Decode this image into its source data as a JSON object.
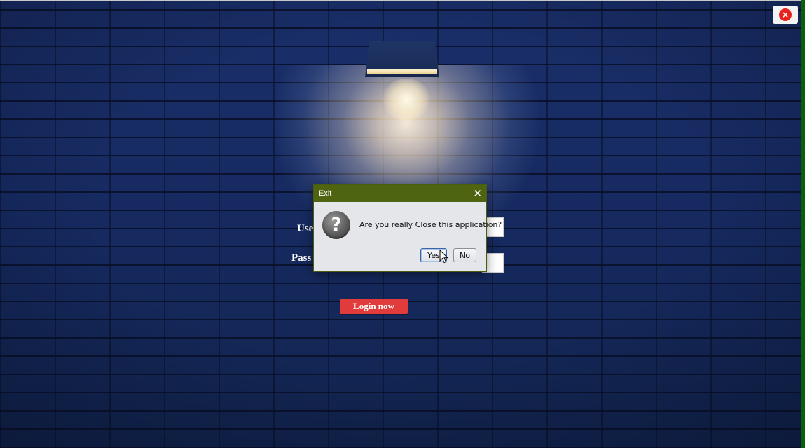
{
  "window": {
    "close_icon": "close-icon",
    "close_glyph": "×",
    "accent": "#e8231f"
  },
  "login": {
    "username_label": "Use",
    "password_label": "Pass",
    "login_button": "Login now",
    "login_button_color": "#e23b3b"
  },
  "dialog": {
    "title": "Exit",
    "close_glyph": "✕",
    "icon": "question-icon",
    "icon_glyph": "?",
    "message": "Are you really Close this application?",
    "yes_label": "Yes",
    "no_label": "No",
    "titlebar_color": "#4f6410"
  }
}
